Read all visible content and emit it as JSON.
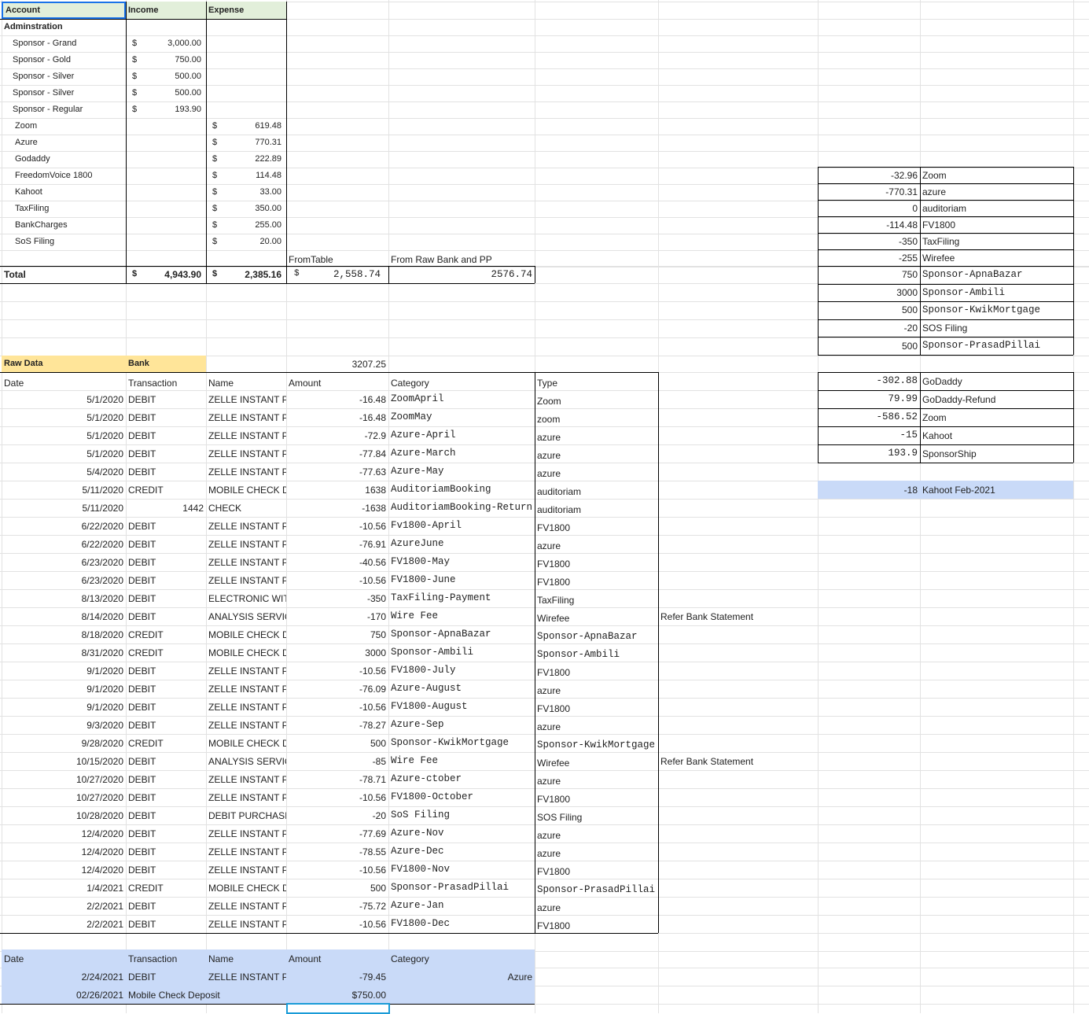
{
  "summary": {
    "headers": {
      "account": "Account",
      "income": "Income",
      "expense": "Expense"
    },
    "section": "Adminstration",
    "income_rows": [
      {
        "account": "Sponsor - Grand",
        "currency": "$",
        "income": "3,000.00"
      },
      {
        "account": "Sponsor - Gold",
        "currency": "$",
        "income": "750.00"
      },
      {
        "account": "Sponsor - Silver",
        "currency": "$",
        "income": "500.00"
      },
      {
        "account": "Sponsor - Silver",
        "currency": "$",
        "income": "500.00"
      },
      {
        "account": "Sponsor - Regular",
        "currency": "$",
        "income": "193.90"
      }
    ],
    "expense_rows": [
      {
        "account": "Zoom",
        "currency": "$",
        "expense": "619.48"
      },
      {
        "account": "Azure",
        "currency": "$",
        "expense": "770.31"
      },
      {
        "account": "Godaddy",
        "currency": "$",
        "expense": "222.89"
      },
      {
        "account": "FreedomVoice 1800",
        "currency": "$",
        "expense": "114.48"
      },
      {
        "account": "Kahoot",
        "currency": "$",
        "expense": "33.00"
      },
      {
        "account": "TaxFiling",
        "currency": "$",
        "expense": "350.00"
      },
      {
        "account": "BankCharges",
        "currency": "$",
        "expense": "255.00"
      },
      {
        "account": "SoS Filing",
        "currency": "$",
        "expense": "20.00"
      }
    ],
    "from_table_label": "FromTable",
    "from_raw_label": "From Raw Bank and PP",
    "total": {
      "label": "Total",
      "income_currency": "$",
      "income": "4,943.90",
      "expense_currency": "$",
      "expense": "2,385.16",
      "from_table_currency": "$",
      "from_table": "2,558.74",
      "from_raw": "2576.74"
    }
  },
  "side_table_1": [
    {
      "amount": "-32.96",
      "label": "Zoom"
    },
    {
      "amount": "-770.31",
      "label": "azure"
    },
    {
      "amount": "0",
      "label": "auditoriam"
    },
    {
      "amount": "-114.48",
      "label": "FV1800"
    },
    {
      "amount": "-350",
      "label": "TaxFiling"
    },
    {
      "amount": "-255",
      "label": "Wirefee"
    },
    {
      "amount": "750",
      "label": "Sponsor-ApnaBazar"
    },
    {
      "amount": "3000",
      "label": "Sponsor-Ambili"
    },
    {
      "amount": "500",
      "label": "Sponsor-KwikMortgage"
    },
    {
      "amount": "-20",
      "label": "SOS Filing"
    },
    {
      "amount": "500",
      "label": "Sponsor-PrasadPillai"
    }
  ],
  "side_table_2": [
    {
      "amount": "-302.88",
      "label": "GoDaddy"
    },
    {
      "amount": "79.99",
      "label": "GoDaddy-Refund"
    },
    {
      "amount": "-586.52",
      "label": "Zoom"
    },
    {
      "amount": "-15",
      "label": "Kahoot"
    },
    {
      "amount": "193.9",
      "label": "SponsorShip"
    }
  ],
  "kahoot_note": {
    "amount": "-18",
    "label": "Kahoot Feb-2021"
  },
  "raw": {
    "title_a": "Raw Data",
    "title_b": "Bank",
    "sum": "3207.25",
    "headers": {
      "date": "Date",
      "transaction": "Transaction",
      "name": "Name",
      "amount": "Amount",
      "category": "Category",
      "type": "Type"
    },
    "rows": [
      {
        "date": "5/1/2020",
        "transaction": "DEBIT",
        "name": "ZELLE INSTANT P",
        "amount": "-16.48",
        "category": "ZoomApril",
        "type": "Zoom",
        "note": ""
      },
      {
        "date": "5/1/2020",
        "transaction": "DEBIT",
        "name": "ZELLE INSTANT P",
        "amount": "-16.48",
        "category": "ZoomMay",
        "type": "zoom",
        "note": ""
      },
      {
        "date": "5/1/2020",
        "transaction": "DEBIT",
        "name": "ZELLE INSTANT P",
        "amount": "-72.9",
        "category": "Azure-April",
        "type": "azure",
        "note": ""
      },
      {
        "date": "5/1/2020",
        "transaction": "DEBIT",
        "name": "ZELLE INSTANT P",
        "amount": "-77.84",
        "category": "Azure-March",
        "type": "azure",
        "note": ""
      },
      {
        "date": "5/4/2020",
        "transaction": "DEBIT",
        "name": "ZELLE INSTANT P",
        "amount": "-77.63",
        "category": "Azure-May",
        "type": "azure",
        "note": ""
      },
      {
        "date": "5/11/2020",
        "transaction": "CREDIT",
        "name": "MOBILE CHECK D",
        "amount": "1638",
        "category": "AuditoriamBooking",
        "type": "auditoriam",
        "note": ""
      },
      {
        "date": "5/11/2020",
        "transaction": "1442",
        "name": "CHECK",
        "amount": "-1638",
        "category": "AuditoriamBooking-Return",
        "type": "auditoriam",
        "note": ""
      },
      {
        "date": "6/22/2020",
        "transaction": "DEBIT",
        "name": "ZELLE INSTANT P",
        "amount": "-10.56",
        "category": "Fv1800-April",
        "type": "FV1800",
        "note": ""
      },
      {
        "date": "6/22/2020",
        "transaction": "DEBIT",
        "name": "ZELLE INSTANT P",
        "amount": "-76.91",
        "category": "AzureJune",
        "type": "azure",
        "note": ""
      },
      {
        "date": "6/23/2020",
        "transaction": "DEBIT",
        "name": "ZELLE INSTANT P",
        "amount": "-40.56",
        "category": "FV1800-May",
        "type": "FV1800",
        "note": ""
      },
      {
        "date": "6/23/2020",
        "transaction": "DEBIT",
        "name": "ZELLE INSTANT P",
        "amount": "-10.56",
        "category": "FV1800-June",
        "type": "FV1800",
        "note": ""
      },
      {
        "date": "8/13/2020",
        "transaction": "DEBIT",
        "name": "ELECTRONIC WIT",
        "amount": "-350",
        "category": "TaxFiling-Payment",
        "type": "TaxFiling",
        "note": ""
      },
      {
        "date": "8/14/2020",
        "transaction": "DEBIT",
        "name": "ANALYSIS SERVIC",
        "amount": "-170",
        "category": "Wire Fee",
        "type": "Wirefee",
        "note": "Refer Bank Statement"
      },
      {
        "date": "8/18/2020",
        "transaction": "CREDIT",
        "name": "MOBILE CHECK D",
        "amount": "750",
        "category": "Sponsor-ApnaBazar",
        "type": "Sponsor-ApnaBazar",
        "note": ""
      },
      {
        "date": "8/31/2020",
        "transaction": "CREDIT",
        "name": "MOBILE CHECK D",
        "amount": "3000",
        "category": "Sponsor-Ambili",
        "type": "Sponsor-Ambili",
        "note": ""
      },
      {
        "date": "9/1/2020",
        "transaction": "DEBIT",
        "name": "ZELLE INSTANT P",
        "amount": "-10.56",
        "category": "FV1800-July",
        "type": "FV1800",
        "note": ""
      },
      {
        "date": "9/1/2020",
        "transaction": "DEBIT",
        "name": "ZELLE INSTANT P",
        "amount": "-76.09",
        "category": "Azure-August",
        "type": "azure",
        "note": ""
      },
      {
        "date": "9/1/2020",
        "transaction": "DEBIT",
        "name": "ZELLE INSTANT P",
        "amount": "-10.56",
        "category": "FV1800-August",
        "type": "FV1800",
        "note": ""
      },
      {
        "date": "9/3/2020",
        "transaction": "DEBIT",
        "name": "ZELLE INSTANT P",
        "amount": "-78.27",
        "category": "Azure-Sep",
        "type": "azure",
        "note": ""
      },
      {
        "date": "9/28/2020",
        "transaction": "CREDIT",
        "name": "MOBILE CHECK D",
        "amount": "500",
        "category": "Sponsor-KwikMortgage",
        "type": "Sponsor-KwikMortgage",
        "note": ""
      },
      {
        "date": "10/15/2020",
        "transaction": "DEBIT",
        "name": "ANALYSIS SERVIC",
        "amount": "-85",
        "category": "Wire Fee",
        "type": "Wirefee",
        "note": "Refer Bank Statement"
      },
      {
        "date": "10/27/2020",
        "transaction": "DEBIT",
        "name": "ZELLE INSTANT P",
        "amount": "-78.71",
        "category": "Azure-ctober",
        "type": "azure",
        "note": ""
      },
      {
        "date": "10/27/2020",
        "transaction": "DEBIT",
        "name": "ZELLE INSTANT P",
        "amount": "-10.56",
        "category": "FV1800-October",
        "type": "FV1800",
        "note": ""
      },
      {
        "date": "10/28/2020",
        "transaction": "DEBIT",
        "name": "DEBIT PURCHASI",
        "amount": "-20",
        "category": "SoS Filing",
        "type": "SOS Filing",
        "note": ""
      },
      {
        "date": "12/4/2020",
        "transaction": "DEBIT",
        "name": "ZELLE INSTANT P",
        "amount": "-77.69",
        "category": "Azure-Nov",
        "type": "azure",
        "note": ""
      },
      {
        "date": "12/4/2020",
        "transaction": "DEBIT",
        "name": "ZELLE INSTANT P",
        "amount": "-78.55",
        "category": "Azure-Dec",
        "type": "azure",
        "note": ""
      },
      {
        "date": "12/4/2020",
        "transaction": "DEBIT",
        "name": "ZELLE INSTANT P",
        "amount": "-10.56",
        "category": "FV1800-Nov",
        "type": "FV1800",
        "note": ""
      },
      {
        "date": "1/4/2021",
        "transaction": "CREDIT",
        "name": "MOBILE CHECK D",
        "amount": "500",
        "category": "Sponsor-PrasadPillai",
        "type": "Sponsor-PrasadPillai",
        "note": ""
      },
      {
        "date": "2/2/2021",
        "transaction": "DEBIT",
        "name": "ZELLE INSTANT P",
        "amount": "-75.72",
        "category": "Azure-Jan",
        "type": "azure",
        "note": ""
      },
      {
        "date": "2/2/2021",
        "transaction": "DEBIT",
        "name": "ZELLE INSTANT P",
        "amount": "-10.56",
        "category": "FV1800-Dec",
        "type": "FV1800",
        "note": ""
      }
    ]
  },
  "pending": {
    "headers": {
      "date": "Date",
      "transaction": "Transaction",
      "name": "Name",
      "amount": "Amount",
      "category": "Category"
    },
    "rows": [
      {
        "date": "2/24/2021",
        "transaction": "DEBIT",
        "name": "ZELLE INSTANT P",
        "amount": "-79.45",
        "category": "Azure"
      },
      {
        "date": "02/26/2021",
        "transaction": "Mobile Check Deposit",
        "name": "",
        "amount": "$750.00",
        "category": ""
      }
    ]
  }
}
